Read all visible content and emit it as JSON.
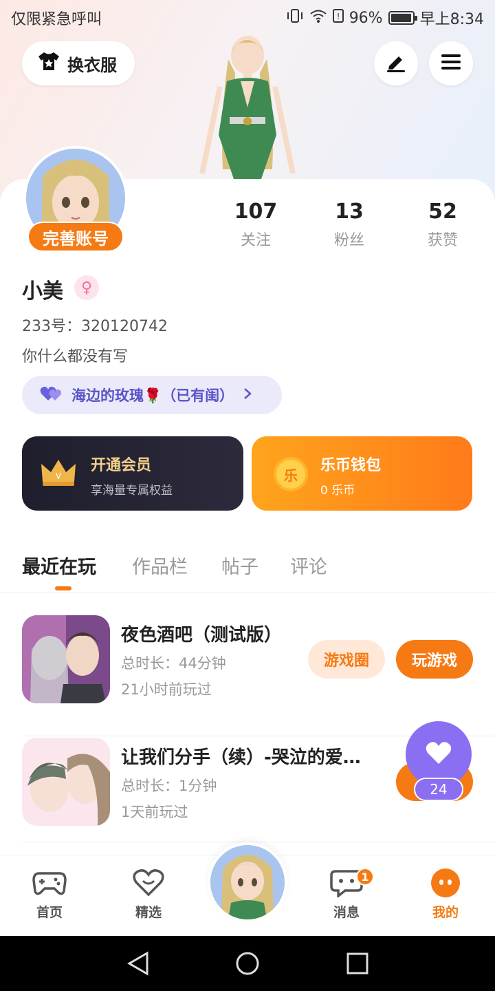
{
  "status_bar": {
    "carrier": "仅限紧急呼叫",
    "battery_pct": "96%",
    "battery_level": 0.96,
    "time": "早上8:34"
  },
  "header": {
    "outfit_label": "换衣服",
    "edit_icon": "pencil-icon",
    "menu_icon": "hamburger-menu-icon"
  },
  "profile": {
    "avatar_tag": "完善账号",
    "username": "小美",
    "gender_symbol": "♀",
    "uid": "233号：320120742",
    "bio": "你什么都没有写",
    "cp_label": "海边的玫瑰🌹（已有闺）",
    "stats": [
      {
        "value": "107",
        "label": "关注"
      },
      {
        "value": "13",
        "label": "粉丝"
      },
      {
        "value": "52",
        "label": "获赞"
      }
    ]
  },
  "cards": {
    "vip": {
      "title": "开通会员",
      "subtitle": "享海量专属权益"
    },
    "wallet": {
      "title": "乐币钱包",
      "subtitle": "0 乐币",
      "coin_char": "乐"
    }
  },
  "tabs": [
    "最近在玩",
    "作品栏",
    "帖子",
    "评论"
  ],
  "games": [
    {
      "title": "夜色酒吧（测试版）",
      "duration": "总时长：44分钟",
      "last_played": "21小时前玩过",
      "circle_label": "游戏圈",
      "play_label": "玩游戏"
    },
    {
      "title": "让我们分手（续）-哭泣的爱…",
      "duration": "总时长：1分钟",
      "last_played": "1天前玩过",
      "circle_label": "",
      "play_label": "玩"
    }
  ],
  "like_float": {
    "count": "24"
  },
  "bottom_nav": {
    "items": [
      {
        "label": "首页",
        "icon": "gamepad-icon"
      },
      {
        "label": "精选",
        "icon": "heart-smile-icon"
      },
      {
        "label": "消息",
        "icon": "chat-bubble-icon",
        "badge": "1"
      },
      {
        "label": "我的",
        "icon": "profile-face-icon"
      }
    ]
  },
  "colors": {
    "accent": "#f57a14",
    "purple": "#8a6ff2",
    "vip_gold": "#f5cf8a"
  }
}
